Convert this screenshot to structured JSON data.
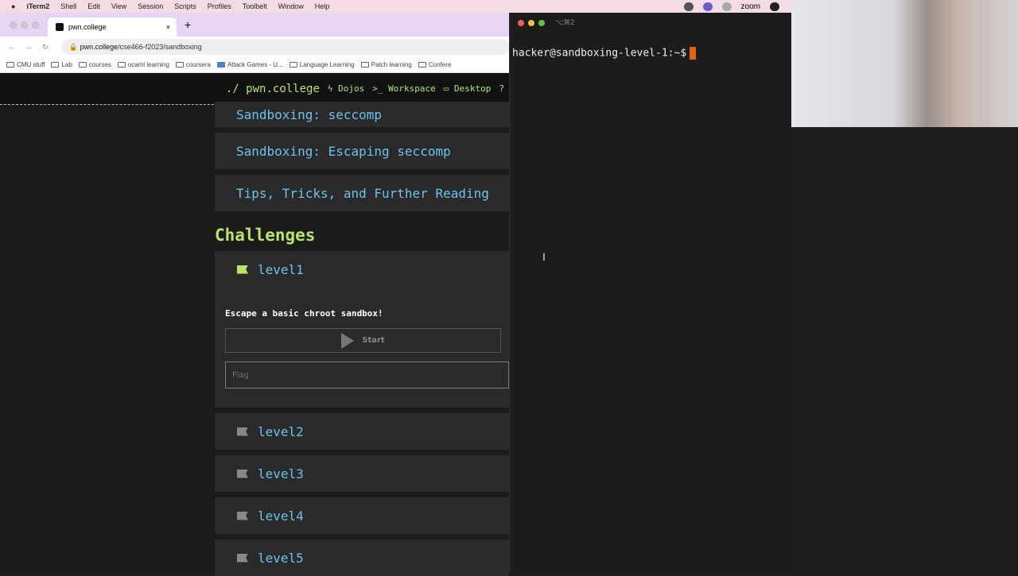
{
  "menubar": {
    "app": "iTerm2",
    "items": [
      "Shell",
      "Edit",
      "View",
      "Session",
      "Scripts",
      "Profiles",
      "Toolbelt",
      "Window",
      "Help"
    ],
    "zoom": "zoom"
  },
  "browser": {
    "tab_title": "pwn.college",
    "close": "×",
    "new_tab": "+",
    "url_host": "pwn.college",
    "url_path": "/cse466-f2023/sandboxing",
    "bookmarks": [
      "CMU stuff",
      "Lab",
      "courses",
      "ocaml learning",
      "coursera",
      "Attack Games - U...",
      "Language Learning",
      "Patch learning",
      "Confere"
    ]
  },
  "sitenav": {
    "brand": "./ pwn.college",
    "dojos": "Dojos",
    "workspace": "Workspace",
    "desktop": "Desktop",
    "help": "?"
  },
  "modules": [
    "Sandboxing: seccomp",
    "Sandboxing: Escaping seccomp",
    "Tips, Tricks, and Further Reading"
  ],
  "challenges": {
    "heading": "Challenges",
    "levels": [
      "level1",
      "level2",
      "level3",
      "level4",
      "level5"
    ],
    "level1": {
      "description": "Escape a basic chroot sandbox!",
      "start_label": "Start",
      "flag_placeholder": "Flag",
      "solved_color": "#b9e46a"
    }
  },
  "terminal": {
    "title": "⌥⌘2",
    "prompt": "hacker@sandboxing-level-1:~$",
    "cursor_color": "#e8620c"
  },
  "webcam": {
    "icon": "webcam-video"
  }
}
